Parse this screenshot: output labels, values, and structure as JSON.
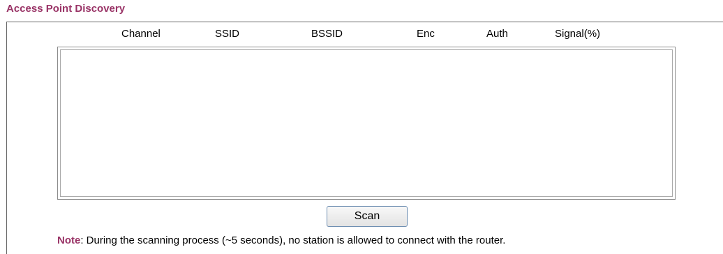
{
  "page": {
    "title": "Access Point Discovery"
  },
  "list": {
    "columns": [
      "Channel",
      "SSID",
      "BSSID",
      "Enc",
      "Auth",
      "Signal(%)"
    ],
    "items": []
  },
  "actions": {
    "scan_label": "Scan"
  },
  "note": {
    "label": "Note",
    "text": ": During the scanning process (~5 seconds), no station is allowed to connect with the router."
  },
  "colors": {
    "title": "#993366",
    "note_label": "#993366"
  }
}
